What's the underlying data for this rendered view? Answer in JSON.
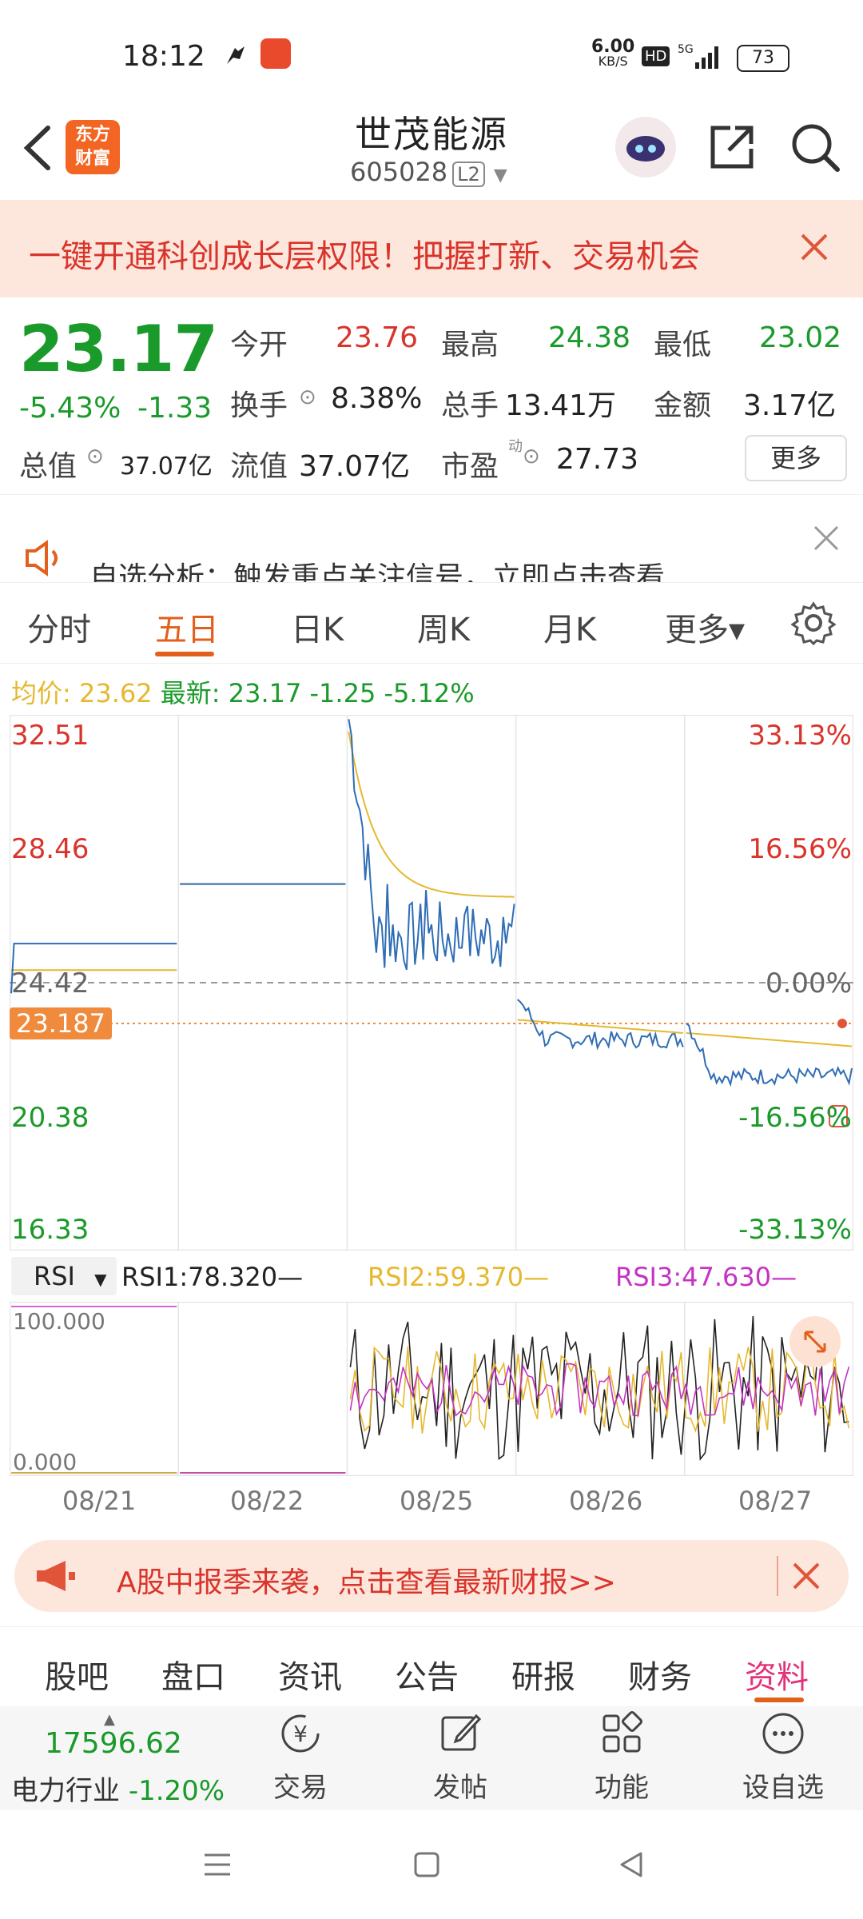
{
  "status": {
    "time": "18:12",
    "net_speed": "6.00",
    "net_unit": "KB/S",
    "hd": "HD",
    "signal": "5G",
    "battery": "73"
  },
  "header": {
    "logo_text": [
      "东方",
      "财富"
    ],
    "title": "世茂能源",
    "code": "605028",
    "level": "L2"
  },
  "banner": {
    "text": "一键开通科创成长层权限！把握打新、交易机会"
  },
  "quote": {
    "price": "23.17",
    "change_pct": "-5.43%",
    "change": "-1.33",
    "open_label": "今开",
    "open": "23.76",
    "high_label": "最高",
    "high": "24.38",
    "low_label": "最低",
    "low": "23.02",
    "turnover_label": "换手",
    "turnover": "8.38%",
    "volume_label": "总手",
    "volume": "13.41万",
    "amount_label": "金额",
    "amount": "3.17亿",
    "mcap_label": "总值",
    "mcap": "37.07亿",
    "float_label": "流值",
    "float": "37.07亿",
    "pe_label": "市盈",
    "pe_sup": "动",
    "pe": "27.73",
    "more": "更多"
  },
  "notice": {
    "text": "自选分析：触发重点关注信号，立即点击查看"
  },
  "tabs": [
    {
      "label": "分时",
      "active": false
    },
    {
      "label": "五日",
      "active": true
    },
    {
      "label": "日K",
      "active": false
    },
    {
      "label": "周K",
      "active": false
    },
    {
      "label": "月K",
      "active": false
    },
    {
      "label": "更多▾",
      "active": false
    }
  ],
  "legend": {
    "avg_label": "均价:",
    "avg": "23.62",
    "last_label": "最新:",
    "last": "23.17",
    "chg": "-1.25",
    "chg_pct": "-5.12%"
  },
  "chart_left_axis": [
    "32.51",
    "28.46",
    "24.42",
    "20.38",
    "16.33"
  ],
  "chart_right_axis": [
    "33.13%",
    "16.56%",
    "0.00%",
    "-16.56%",
    "-33.13%"
  ],
  "current_price_tag": "23.187",
  "rsi": {
    "selector": "RSI",
    "rsi1": "RSI1:78.320—",
    "rsi2": "RSI2:59.370—",
    "rsi3": "RSI3:47.630—",
    "top": "100.000",
    "bottom": "0.000"
  },
  "dates": [
    "08/21",
    "08/22",
    "08/25",
    "08/26",
    "08/27"
  ],
  "ad": {
    "text": "A股中报季来袭，点击查看最新财报>>"
  },
  "bottom_tabs": [
    {
      "label": "股吧",
      "active": false
    },
    {
      "label": "盘口",
      "active": false
    },
    {
      "label": "资讯",
      "active": false
    },
    {
      "label": "公告",
      "active": false
    },
    {
      "label": "研报",
      "active": false
    },
    {
      "label": "财务",
      "active": false
    },
    {
      "label": "资料",
      "active": true
    }
  ],
  "sector": {
    "value": "17596.62",
    "name": "电力行业",
    "chg": "-1.20%"
  },
  "bottom_nav": [
    "交易",
    "发帖",
    "功能",
    "设自选"
  ],
  "colors": {
    "up": "#d9342b",
    "down": "#1a9a2a",
    "accent": "#e2601b",
    "price_line": "#2f6db5",
    "avg_line": "#e6b82e"
  },
  "chart_data": {
    "type": "line",
    "x": [
      "08/21",
      "08/22",
      "08/25",
      "08/26",
      "08/27"
    ],
    "prev_close": 24.42,
    "ylim": [
      16.33,
      32.51
    ],
    "series": [
      {
        "name": "",
        "values": [
          25.6,
          27.4,
          25.8,
          22.7,
          21.6
        ]
      },
      {
        "name": "均价",
        "values": [
          24.8,
          27.4,
          27.0,
          23.3,
          22.9
        ]
      }
    ]
  }
}
